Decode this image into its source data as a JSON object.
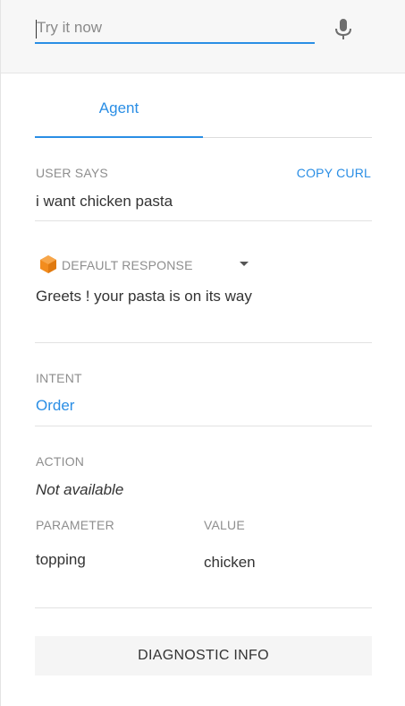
{
  "search": {
    "placeholder": "Try it now",
    "value": "",
    "mic_icon": "microphone-icon"
  },
  "tabs": [
    {
      "label": "Agent",
      "active": true
    }
  ],
  "user_says": {
    "label": "USER SAYS",
    "copy_label": "COPY CURL",
    "text": "i want chicken pasta"
  },
  "response": {
    "icon": "dialogflow-cube-icon",
    "label": "DEFAULT RESPONSE",
    "dropdown_icon": "caret-down-icon",
    "text": "Greets ! your pasta is on its way"
  },
  "intent": {
    "label": "INTENT",
    "value": "Order"
  },
  "action": {
    "label": "ACTION",
    "value": "Not available"
  },
  "parameters": {
    "col_parameter": "PARAMETER",
    "col_value": "VALUE",
    "rows": [
      {
        "parameter": "topping",
        "value": "chicken"
      }
    ]
  },
  "diagnostic": {
    "label": "DIAGNOSTIC INFO"
  },
  "colors": {
    "accent": "#2a8ee5",
    "cube": "#f28c1e"
  }
}
